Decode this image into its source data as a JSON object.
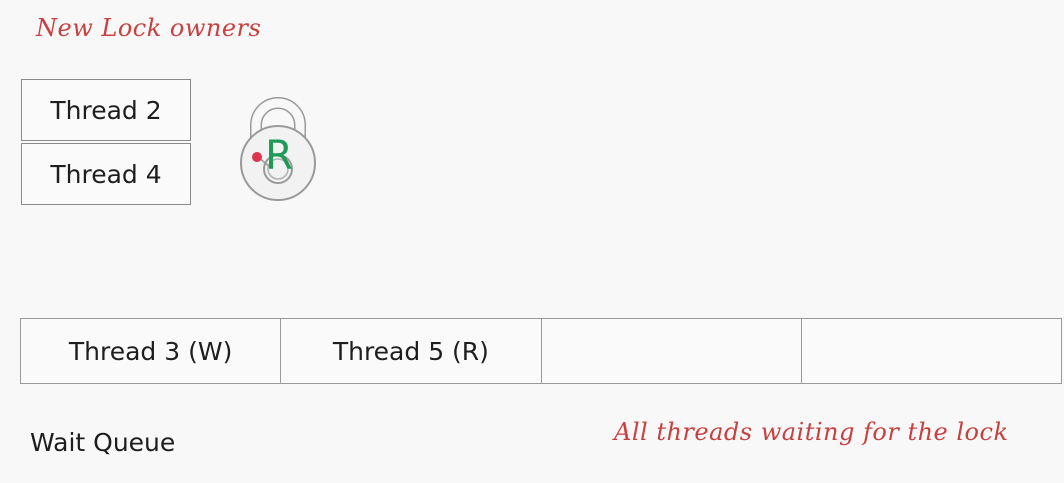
{
  "annotations": {
    "owners_title": "New Lock owners",
    "queue_note": "All threads waiting for the lock"
  },
  "lock_owners": [
    "Thread 2",
    "Thread 4"
  ],
  "lock": {
    "mode_letter": "R",
    "icon": "padlock-icon",
    "letter_color": "#1e9a55",
    "dot_color": "#e0334d"
  },
  "wait_queue": {
    "label": "Wait Queue",
    "slots": [
      "Thread 3 (W)",
      "Thread 5 (R)",
      "",
      ""
    ]
  },
  "colors": {
    "annotation": "#c94040",
    "border": "#8a8a8a",
    "background": "#f8f8f8"
  }
}
